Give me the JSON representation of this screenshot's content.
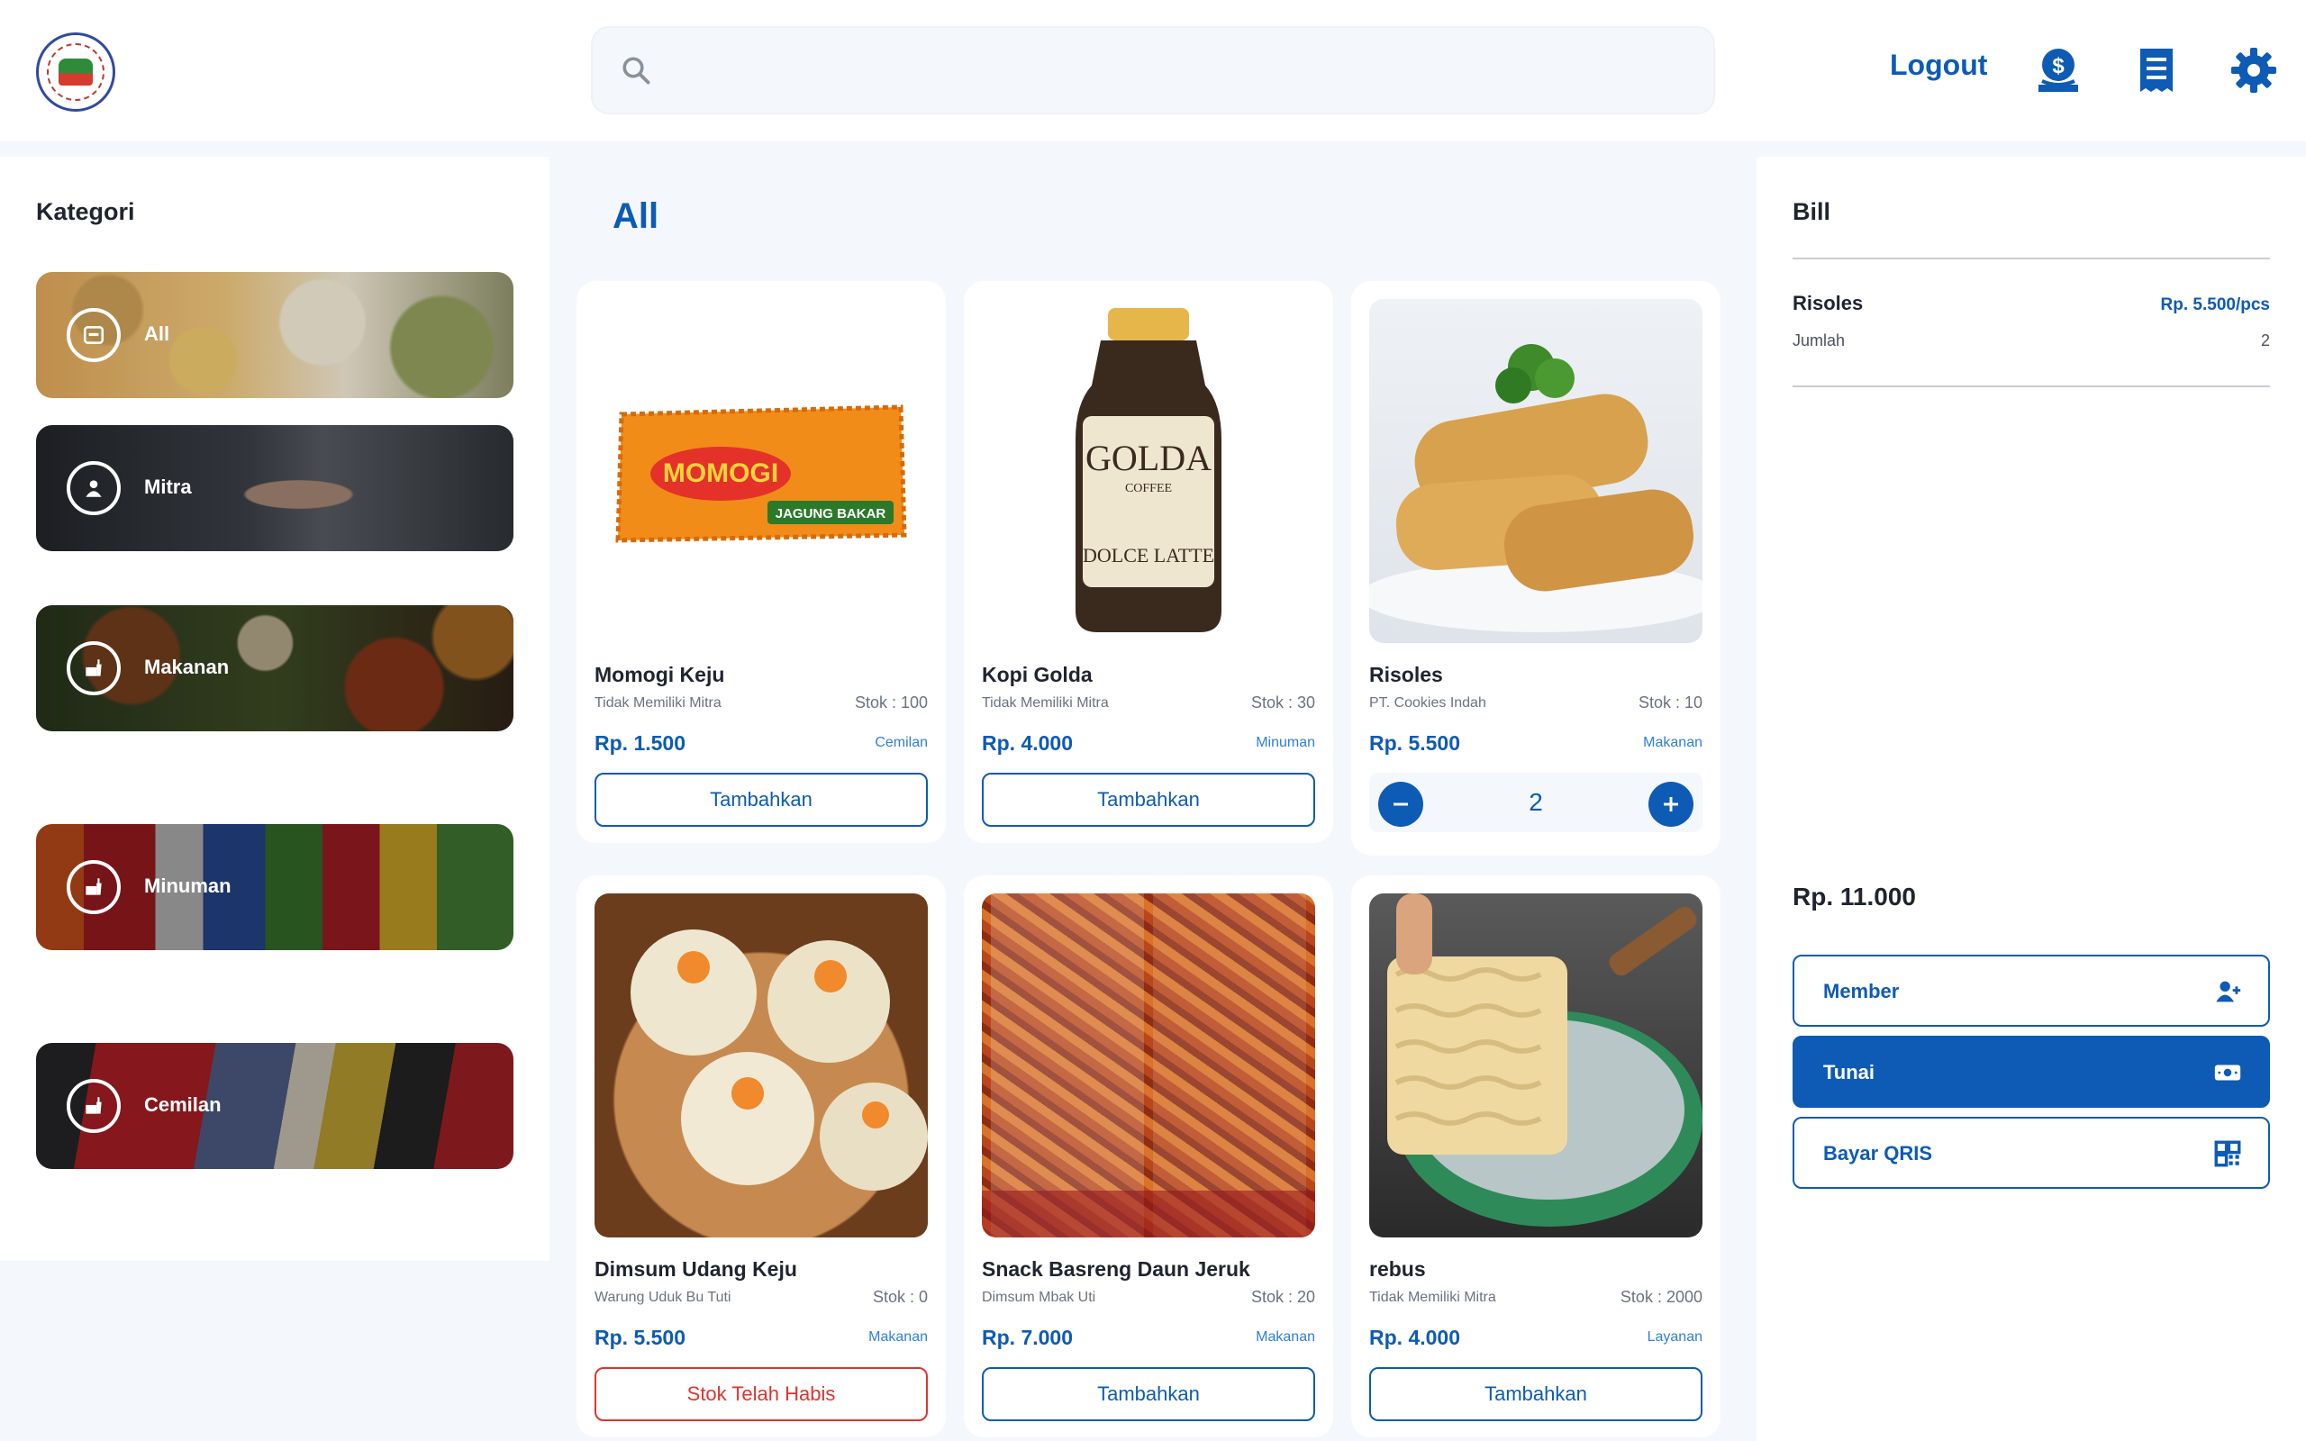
{
  "header": {
    "search_placeholder": "",
    "logout_label": "Logout",
    "icons": [
      "logo-seal",
      "search-icon",
      "cash-deposit-icon",
      "receipt-icon",
      "gear-icon"
    ]
  },
  "sidebar": {
    "title": "Kategori",
    "items": [
      {
        "label": "All",
        "icon": "all-icon"
      },
      {
        "label": "Mitra",
        "icon": "person-icon"
      },
      {
        "label": "Makanan",
        "icon": "food-icon"
      },
      {
        "label": "Minuman",
        "icon": "food-icon"
      },
      {
        "label": "Cemilan",
        "icon": "food-icon"
      }
    ]
  },
  "main": {
    "title": "All",
    "products": [
      {
        "name": "Momogi Keju",
        "mitra": "Tidak Memiliki Mitra",
        "stok": "Stok : 100",
        "price": "Rp. 1.500",
        "kategori": "Cemilan",
        "action": "Tambahkan"
      },
      {
        "name": "Kopi Golda",
        "mitra": "Tidak Memiliki Mitra",
        "stok": "Stok : 30",
        "price": "Rp. 4.000",
        "kategori": "Minuman",
        "action": "Tambahkan"
      },
      {
        "name": "Risoles",
        "mitra": "PT. Cookies Indah",
        "stok": "Stok : 10",
        "price": "Rp. 5.500",
        "kategori": "Makanan",
        "quantity": "2"
      },
      {
        "name": "Dimsum Udang Keju",
        "mitra": "Warung Uduk Bu Tuti",
        "stok": "Stok : 0",
        "price": "Rp. 5.500",
        "kategori": "Makanan",
        "action": "Stok Telah Habis"
      },
      {
        "name": "Snack Basreng Daun Jeruk",
        "mitra": "Dimsum Mbak Uti",
        "stok": "Stok : 20",
        "price": "Rp. 7.000",
        "kategori": "Makanan",
        "action": "Tambahkan"
      },
      {
        "name": "rebus",
        "mitra": "Tidak Memiliki Mitra",
        "stok": "Stok : 2000",
        "price": "Rp. 4.000",
        "kategori": "Layanan",
        "action": "Tambahkan"
      }
    ]
  },
  "bill": {
    "title": "Bill",
    "items": [
      {
        "name": "Risoles",
        "unit_price": "Rp. 5.500/pcs",
        "jumlah_label": "Jumlah",
        "jumlah": "2"
      }
    ],
    "total": "Rp. 11.000",
    "payments": [
      {
        "label": "Member",
        "icon": "member-icon",
        "active": false
      },
      {
        "label": "Tunai",
        "icon": "cash-icon",
        "active": true
      },
      {
        "label": "Bayar QRIS",
        "icon": "qr-icon",
        "active": false
      }
    ]
  },
  "colors": {
    "accent": "#0d5bb5",
    "danger": "#e0342f",
    "background": "#f4f7fc"
  }
}
